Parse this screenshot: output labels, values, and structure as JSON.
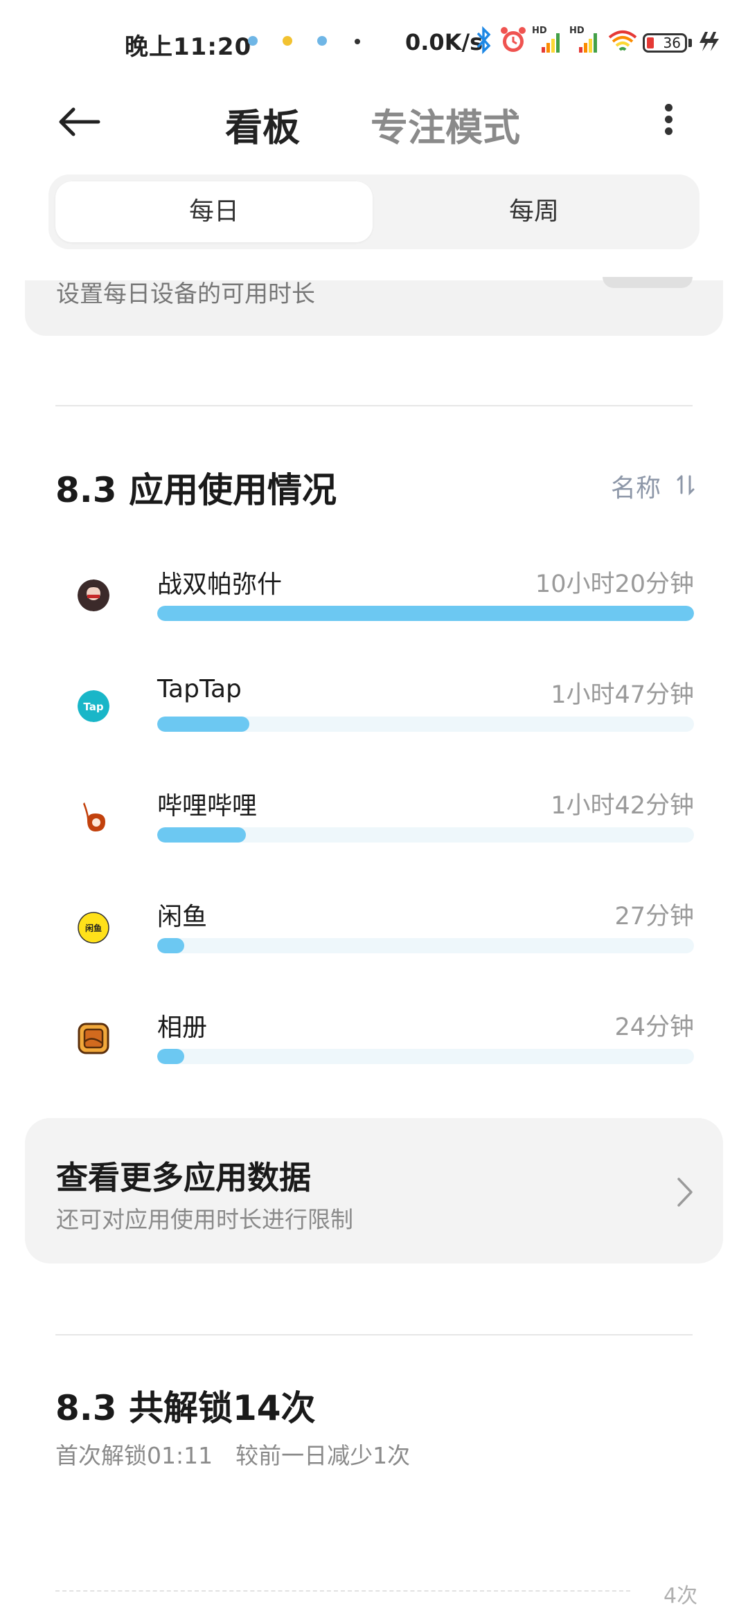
{
  "status_bar": {
    "time": "晚上11:20",
    "net_speed": "0.0K/s",
    "battery": "36",
    "icons": [
      "notification-dot-icon",
      "emoji-icon",
      "notification-dot-icon",
      "dot-icon",
      "bluetooth-icon",
      "alarm-icon",
      "signal-hd-icon",
      "signal-hd-icon",
      "wifi-icon",
      "battery-icon",
      "charging-icon"
    ],
    "hd_label": "HD"
  },
  "header": {
    "tab_active": "看板",
    "tab_inactive": "专注模式"
  },
  "segment": {
    "daily": "每日",
    "weekly": "每周",
    "selected": "每日"
  },
  "partial_card": {
    "text": "设置每日设备的可用时长"
  },
  "app_usage": {
    "title": "8.3 应用使用情况",
    "sort_label": "名称",
    "apps": [
      {
        "name": "战双帕弥什",
        "time": "10小时20分钟",
        "fraction": 1.0,
        "icon": "game-avatar-icon"
      },
      {
        "name": "TapTap",
        "time": "1小时47分钟",
        "fraction": 0.172,
        "icon": "taptap-icon"
      },
      {
        "name": "哔哩哔哩",
        "time": "1小时42分钟",
        "fraction": 0.165,
        "icon": "bilibili-icon"
      },
      {
        "name": "闲鱼",
        "time": "27分钟",
        "fraction": 0.05,
        "icon": "xianyu-icon"
      },
      {
        "name": "相册",
        "time": "24分钟",
        "fraction": 0.05,
        "icon": "gallery-icon"
      }
    ],
    "bar_color": "#6cc8f2",
    "track_color": "#eef7fb"
  },
  "more_card": {
    "title": "查看更多应用数据",
    "subtitle": "还可对应用使用时长进行限制"
  },
  "unlock": {
    "title": "8.3 共解锁14次",
    "subtitle": "首次解锁01:11　较前一日减少1次",
    "chart_label": "4次"
  }
}
